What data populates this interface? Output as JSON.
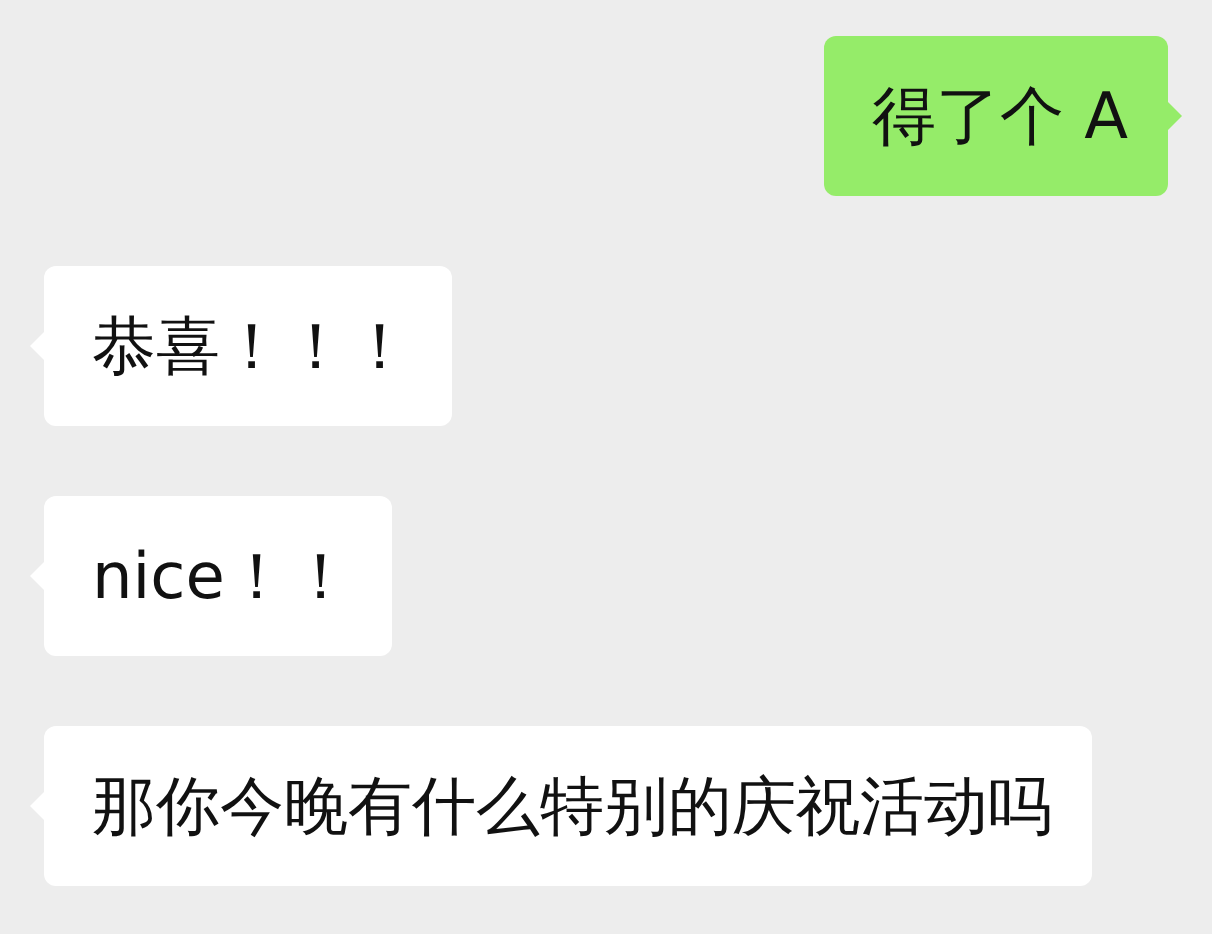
{
  "messages": [
    {
      "kind": "sent",
      "text": "得了个 A"
    },
    {
      "kind": "received",
      "text": "恭喜！！！"
    },
    {
      "kind": "received",
      "text": "nice！！"
    },
    {
      "kind": "received",
      "text": "那你今晚有什么特别的庆祝活动吗"
    }
  ]
}
